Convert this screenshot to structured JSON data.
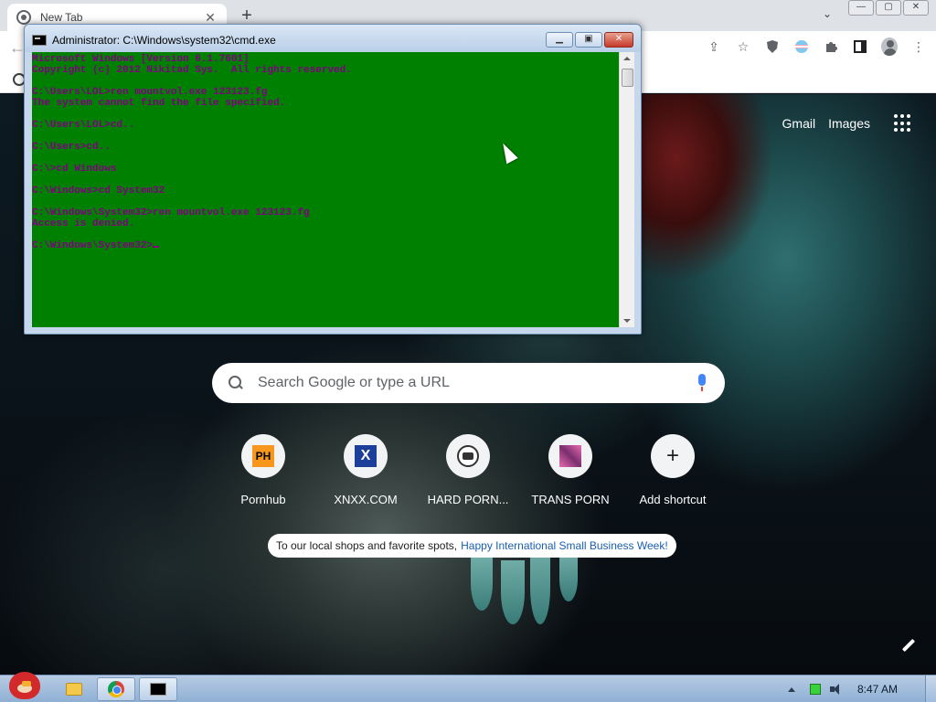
{
  "browser": {
    "tab_title": "New Tab",
    "tab_close": "✕",
    "new_tab": "+",
    "tab_search": "⌄",
    "window_controls": [
      "—",
      "▢",
      "✕"
    ]
  },
  "ntp": {
    "links": {
      "gmail": "Gmail",
      "images": "Images"
    },
    "search_placeholder": "Search Google or type a URL",
    "shortcuts": [
      {
        "label": "Pornhub",
        "icon": "ph-logo",
        "glyph": "PH"
      },
      {
        "label": "XNXX.COM",
        "icon": "xnxx-logo",
        "glyph": "X"
      },
      {
        "label": "HARD PORN...",
        "icon": "raccoon-logo",
        "glyph": ""
      },
      {
        "label": "TRANS PORN",
        "icon": "trans-porn-logo",
        "glyph": ""
      },
      {
        "label": "Add shortcut",
        "icon": "plus-icon",
        "glyph": "+"
      }
    ],
    "promo_text": "To our local shops and favorite spots,",
    "promo_link": "Happy International Small Business Week!"
  },
  "cmd": {
    "title": "Administrator: C:\\Windows\\system32\\cmd.exe",
    "controls": [
      "▁",
      "▣",
      "✕"
    ],
    "lines": [
      "Microsoft Windows [Version 6.1.7601]",
      "Copyright (c) 2012 Nikitad Sys.  All rights reserved.",
      "",
      "C:\\Users\\LOL>ren mountvol.exe 123123.fg",
      "The system cannot find the file specified.",
      "",
      "C:\\Users\\LOL>cd..",
      "",
      "C:\\Users>cd..",
      "",
      "C:\\>cd Windows",
      "",
      "C:\\Windows>cd System32",
      "",
      "C:\\Windows\\System32>ren mountvol.exe 123123.fg",
      "Access is denied.",
      "",
      "C:\\Windows\\System32>"
    ]
  },
  "taskbar": {
    "clock": "8:47 AM"
  },
  "colors": {
    "console_bg": "#008000",
    "console_fg": "#800080"
  }
}
